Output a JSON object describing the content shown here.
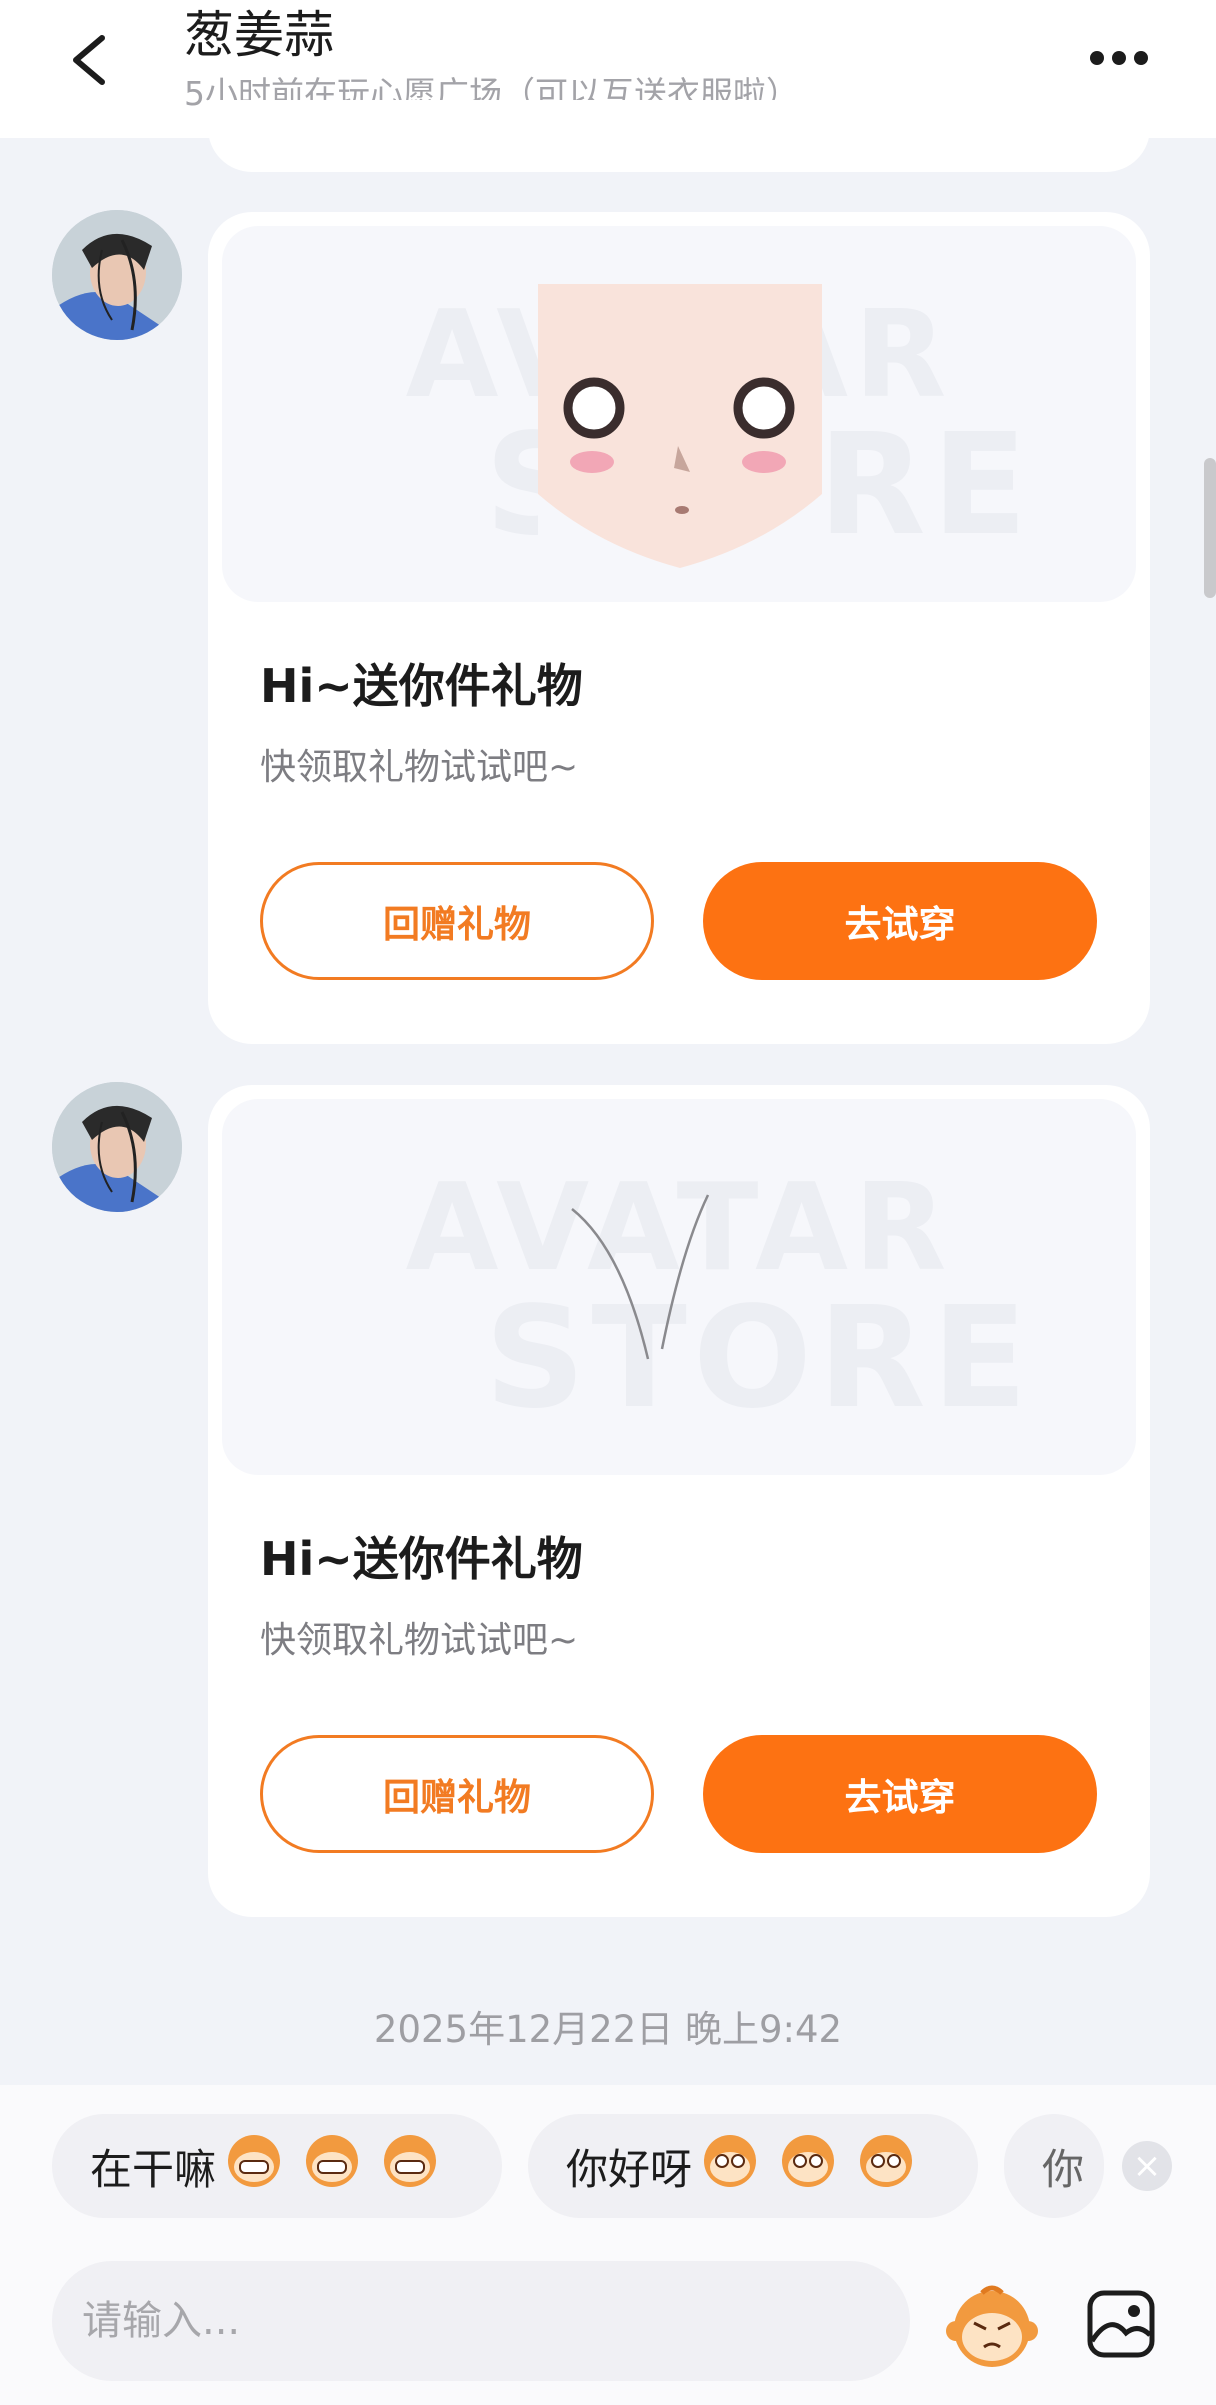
{
  "header": {
    "title": "葱姜蒜",
    "subtitle": "5小时前在玩心愿广场（可以互送衣服啦）"
  },
  "messages": [
    {
      "card_title": "Hi~送你件礼物",
      "card_desc": "快领取礼物试试吧~",
      "watermark_line1": "AVATAR",
      "watermark_line2": "STORE",
      "return_gift_label": "回赠礼物",
      "try_on_label": "去试穿"
    },
    {
      "card_title": "Hi~送你件礼物",
      "card_desc": "快领取礼物试试吧~",
      "watermark_line1": "AVATAR",
      "watermark_line2": "STORE",
      "return_gift_label": "回赠礼物",
      "try_on_label": "去试穿"
    }
  ],
  "timestamp": "2025年12月22日 晚上9:42",
  "quick_replies": [
    {
      "text": "在干嘛",
      "icon": "grinning-monkey-icon"
    },
    {
      "text": "你好呀",
      "icon": "monkey-face-icon"
    },
    {
      "text": "你",
      "icon": ""
    }
  ],
  "input": {
    "placeholder": "请输入..."
  },
  "colors": {
    "accent": "#fd7212",
    "outline": "#f27b22",
    "background": "#f1f3f8"
  }
}
